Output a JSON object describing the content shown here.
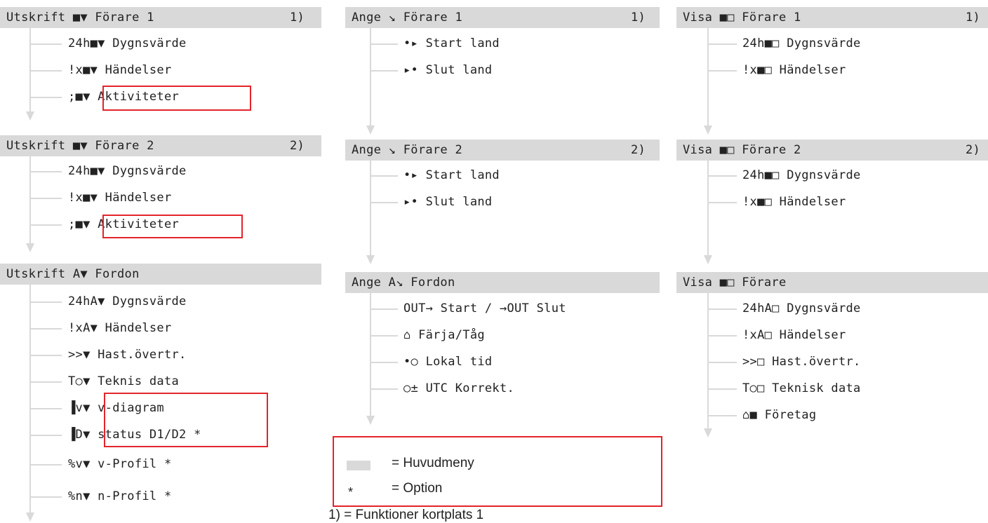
{
  "columns": [
    {
      "sections": [
        {
          "title": "Utskrift ■▼ Förare 1",
          "note": "1)",
          "items": [
            "24h■▼ Dygnsvärde",
            "!x■▼ Händelser",
            ";■▼ Aktiviteter"
          ]
        },
        {
          "title": "Utskrift ■▼ Förare 2",
          "note": "2)",
          "items": [
            "24h■▼ Dygnsvärde",
            "!x■▼ Händelser",
            ";■▼ Aktiviteter"
          ]
        },
        {
          "title": "Utskrift A▼ Fordon",
          "note": "",
          "items": [
            "24hA▼ Dygnsvärde",
            "!xA▼ Händelser",
            ">>▼ Hast.övertr.",
            "T○▼ Teknis data",
            "▐v▼ v-diagram",
            "▐D▼ status D1/D2 *",
            "%v▼ v-Profil *",
            "%n▼ n-Profil *"
          ]
        }
      ]
    },
    {
      "sections": [
        {
          "title": "Ange ↘ Förare 1",
          "note": "1)",
          "items": [
            "•▸ Start land",
            "▸• Slut land"
          ]
        },
        {
          "title": "Ange ↘ Förare 2",
          "note": "2)",
          "items": [
            "•▸ Start land",
            "▸• Slut land"
          ]
        },
        {
          "title": "Ange A↘ Fordon",
          "note": "",
          "items": [
            "OUT→ Start / →OUT Slut",
            "⌂ Färja/Tåg",
            "•○ Lokal tid",
            "○± UTC Korrekt."
          ]
        }
      ]
    },
    {
      "sections": [
        {
          "title": "Visa ■□ Förare 1",
          "note": "1)",
          "items": [
            "24h■□ Dygnsvärde",
            "!x■□ Händelser"
          ]
        },
        {
          "title": "Visa ■□ Förare 2",
          "note": "2)",
          "items": [
            "24h■□ Dygnsvärde",
            "!x■□ Händelser"
          ]
        },
        {
          "title": "Visa ■□ Förare",
          "note": "",
          "items": [
            "24hA□ Dygnsvärde",
            "!xA□ Händelser",
            ">>□ Hast.övertr.",
            "T○□ Teknisk data",
            "⌂■ Företag"
          ]
        }
      ]
    }
  ],
  "legend": {
    "main_menu_symbol_meaning": "= Huvudmeny",
    "option_marker": "*",
    "option_meaning": "= Option"
  },
  "footnote": "1) = Funktioner kortplats 1",
  "colors": {
    "header_bg": "#d9d9d9",
    "highlight": "#e3242b"
  }
}
